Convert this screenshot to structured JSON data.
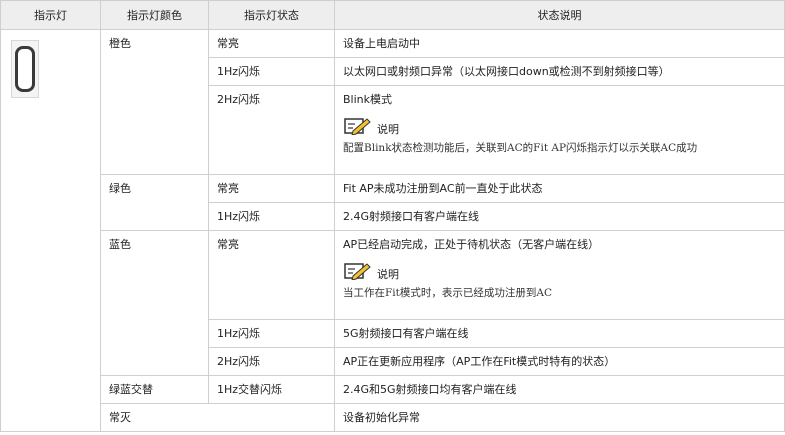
{
  "headers": [
    "指示灯",
    "指示灯颜色",
    "指示灯状态",
    "状态说明"
  ],
  "rows": {
    "orange": {
      "color": "橙色",
      "s1": {
        "state": "常亮",
        "desc": "设备上电启动中"
      },
      "s2": {
        "state": "1Hz闪烁",
        "desc": "以太网口或射频口异常（以太网接口down或检测不到射频接口等）"
      },
      "s3": {
        "state": "2Hz闪烁",
        "desc": "Blink模式",
        "note_label": "说明",
        "note_text": "配置Blink状态检测功能后，关联到AC的Fit AP闪烁指示灯以示关联AC成功"
      }
    },
    "green": {
      "color": "绿色",
      "s1": {
        "state": "常亮",
        "desc": "Fit AP未成功注册到AC前一直处于此状态"
      },
      "s2": {
        "state": "1Hz闪烁",
        "desc": "2.4G射频接口有客户端在线"
      }
    },
    "blue": {
      "color": "蓝色",
      "s1": {
        "state": "常亮",
        "desc": "AP已经启动完成，正处于待机状态（无客户端在线）",
        "note_label": "说明",
        "note_text": "当工作在Fit模式时，表示已经成功注册到AC"
      },
      "s2": {
        "state": "1Hz闪烁",
        "desc": "5G射频接口有客户端在线"
      },
      "s3": {
        "state": "2Hz闪烁",
        "desc": "AP正在更新应用程序（AP工作在Fit模式时特有的状态）"
      }
    },
    "greenblue": {
      "color": "绿蓝交替",
      "s1": {
        "state": "1Hz交替闪烁",
        "desc": "2.4G和5G射频接口均有客户端在线"
      }
    },
    "off": {
      "color": "常灭",
      "desc": "设备初始化异常"
    }
  },
  "icons": {
    "led": "led-indicator-icon",
    "note": "note-pencil-icon"
  }
}
